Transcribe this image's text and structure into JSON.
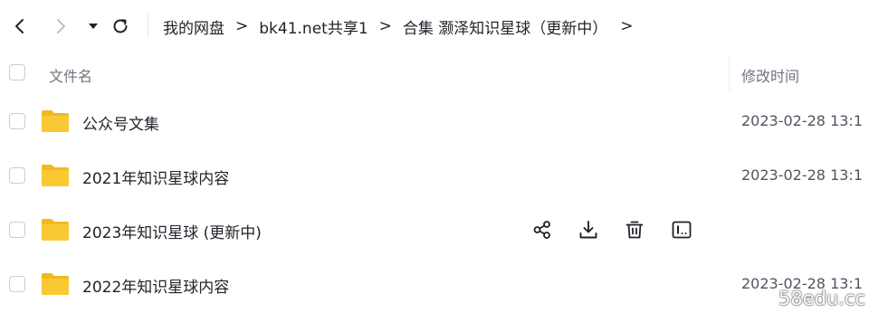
{
  "breadcrumb": [
    {
      "label": "我的网盘"
    },
    {
      "label": "bk41.net共享1"
    },
    {
      "label": "合集 灏泽知识星球（更新中）"
    }
  ],
  "breadcrumb_separator": ">",
  "breadcrumb_trailing": ">",
  "header": {
    "name_label": "文件名",
    "time_label": "修改时间"
  },
  "files": [
    {
      "name": "公众号文集",
      "modified": "2023-02-28 13:1"
    },
    {
      "name": "2021年知识星球内容",
      "modified": "2023-02-28 13:1"
    },
    {
      "name": "2023年知识星球 (更新中)",
      "modified": ""
    },
    {
      "name": "2022年知识星球内容",
      "modified": "2023-02-28 13:1"
    }
  ],
  "hover_actions": [
    "share-icon",
    "download-icon",
    "delete-icon",
    "rename-icon"
  ],
  "colors": {
    "folder": "#f9c934",
    "folder_tab": "#f4b81f"
  },
  "watermark": "58edu.cc"
}
